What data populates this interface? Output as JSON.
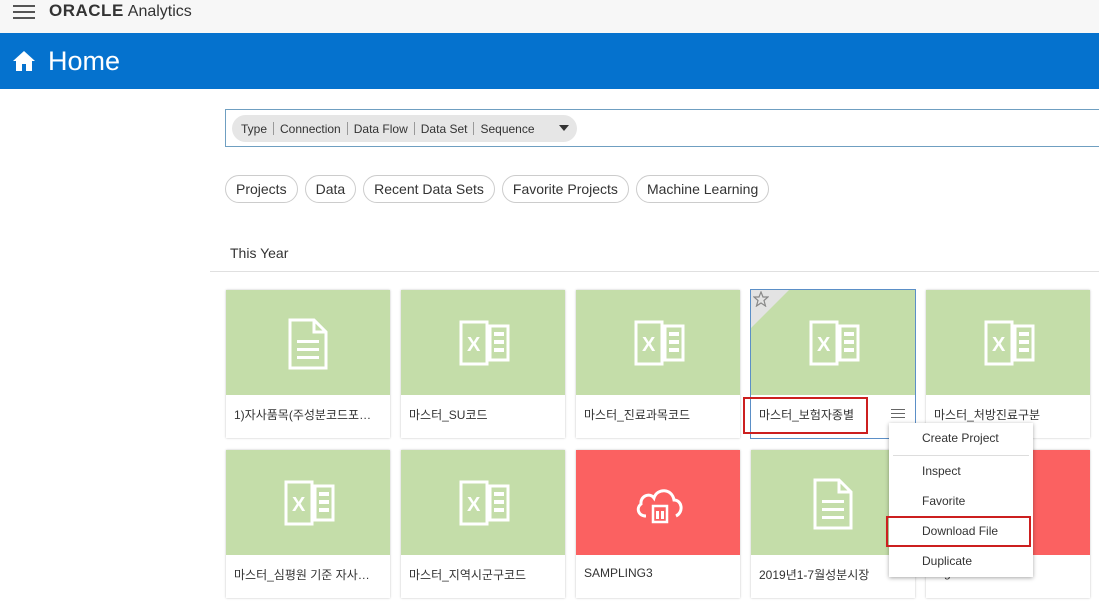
{
  "app": {
    "brand": "ORACLE",
    "product": "Analytics"
  },
  "header": {
    "title": "Home"
  },
  "filter": {
    "type_label": "Type",
    "options": [
      "Connection",
      "Data Flow",
      "Data Set",
      "Sequence"
    ]
  },
  "pills": [
    "Projects",
    "Data",
    "Recent Data Sets",
    "Favorite Projects",
    "Machine Learning"
  ],
  "section": {
    "title": "This Year"
  },
  "cards": [
    {
      "label": "1)자사품목(주성분코드포…",
      "icon": "document-icon",
      "color": "#c4dda9"
    },
    {
      "label": "마스터_SU코드",
      "icon": "excel-icon",
      "color": "#c4dda9"
    },
    {
      "label": "마스터_진료과목코드",
      "icon": "excel-icon",
      "color": "#c4dda9"
    },
    {
      "label": "마스터_보험자종별",
      "icon": "excel-icon",
      "color": "#c4dda9"
    },
    {
      "label": "마스터_처방진료구분",
      "icon": "excel-icon",
      "color": "#c4dda9"
    },
    {
      "label": "마스터_심평원 기준 자사…",
      "icon": "excel-icon",
      "color": "#c4dda9"
    },
    {
      "label": "마스터_지역시군구코드",
      "icon": "excel-icon",
      "color": "#c4dda9"
    },
    {
      "label": "SAMPLING3",
      "icon": "cloud-database-icon",
      "color": "#fb6161"
    },
    {
      "label": "2019년1-7월성분시장",
      "icon": "document-icon",
      "color": "#c4dda9"
    },
    {
      "label": "Ingredientmarket",
      "icon": "data-icon",
      "color": "#fb6161"
    }
  ],
  "context_menu": {
    "items": [
      "Create Project",
      "Inspect",
      "Favorite",
      "Download File",
      "Duplicate"
    ]
  },
  "colors": {
    "header": "#0572ce",
    "accent_green": "#c4dda9",
    "accent_red": "#fb6161",
    "highlight": "#cc1f1f"
  }
}
